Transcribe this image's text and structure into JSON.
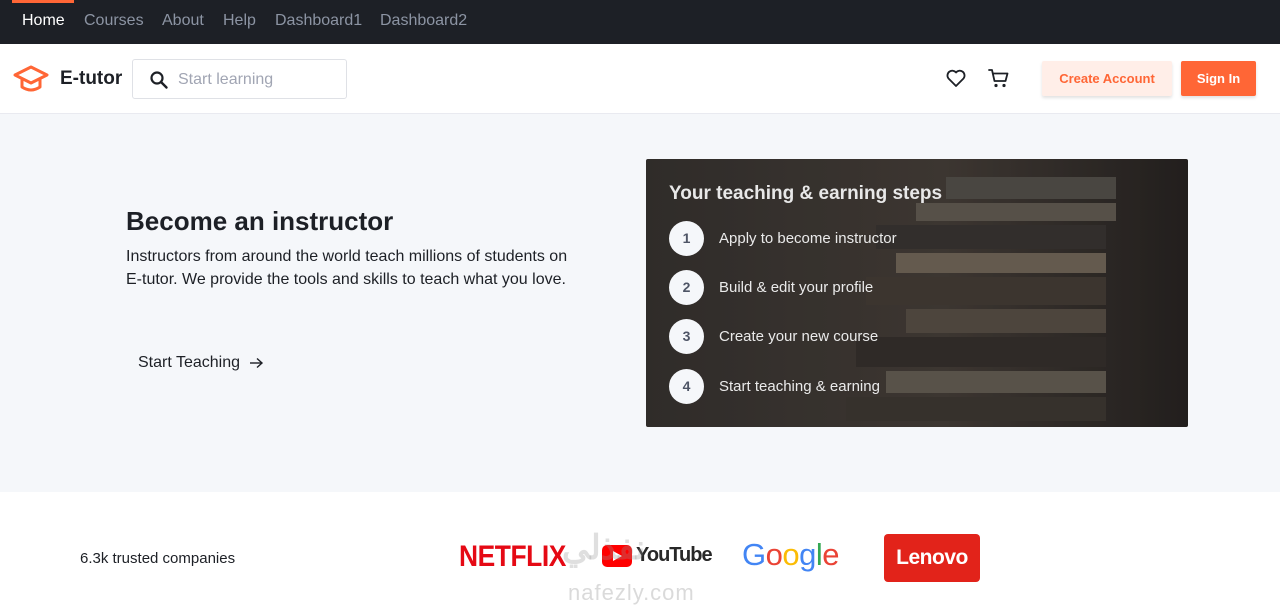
{
  "topnav": {
    "items": [
      {
        "label": "Home",
        "active": true
      },
      {
        "label": "Courses"
      },
      {
        "label": "About"
      },
      {
        "label": "Help"
      },
      {
        "label": "Dashboard1"
      },
      {
        "label": "Dashboard2"
      }
    ]
  },
  "header": {
    "brand": "E-tutor",
    "search_placeholder": "Start learning",
    "create_account_label": "Create Account",
    "sign_in_label": "Sign In"
  },
  "hero": {
    "title": "Become an instructor",
    "description": "Instructors from around the world teach millions of students on E-tutor. We provide the tools and skills to teach what you love.",
    "cta_label": "Start Teaching"
  },
  "steps": {
    "title": "Your teaching & earning steps",
    "items": [
      {
        "number": "1",
        "label": "Apply to become instructor"
      },
      {
        "number": "2",
        "label": "Build & edit your profile"
      },
      {
        "number": "3",
        "label": "Create your new course"
      },
      {
        "number": "4",
        "label": "Start teaching & earning"
      }
    ]
  },
  "companies": {
    "count_text": "6.3k trusted companies",
    "logos": [
      "NETFLIX",
      "YouTube",
      "Google",
      "Lenovo"
    ]
  },
  "watermark": {
    "latin": "nafezly.com",
    "arabic": "نفذلي"
  },
  "colors": {
    "accent": "#ff6636",
    "accent_light": "#ffeee8",
    "nav_bg": "#1d2026",
    "hero_bg": "#f5f7fa"
  }
}
